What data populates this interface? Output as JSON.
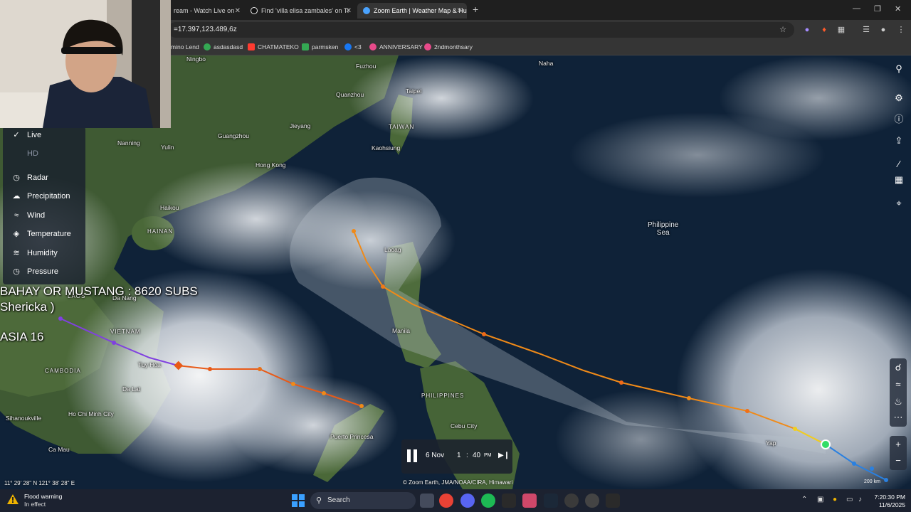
{
  "browser": {
    "tabs": [
      {
        "title": "ream - Watch Live on",
        "active": false
      },
      {
        "title": "Find 'villa elisa zambales' on Ti",
        "active": false
      },
      {
        "title": "Zoom Earth | Weather Map & Hu",
        "active": true
      }
    ],
    "url": "=17.397,123.489,6z",
    "bookmarks": [
      {
        "label": "mino Lend",
        "color": "#c9c9c9"
      },
      {
        "label": "asdasdasd",
        "color": "#34a853"
      },
      {
        "label": "CHATMATEKO",
        "color": "#ff3b30"
      },
      {
        "label": "parmsken",
        "color": "#34a853"
      },
      {
        "label": "<3",
        "color": "#1877f2"
      },
      {
        "label": "ANNIVERSARY",
        "color": "#e84a8a"
      },
      {
        "label": "2ndmonthsary",
        "color": "#e84a8a"
      }
    ]
  },
  "map": {
    "places": {
      "ningbo": "Ningbo",
      "fuzhou": "Fuzhou",
      "quanzhou": "Quanzhou",
      "taipei": "Taipei",
      "naha": "Naha",
      "jieyang": "Jieyang",
      "guangzhou": "Guangzhou",
      "taiwan": "TAIWAN",
      "kaohsiung": "Kaohsiung",
      "nanning": "Nanning",
      "yulin": "Yulin",
      "hongkong": "Hong Kong",
      "haikou": "Haikou",
      "hainan": "HAINAN",
      "philippine_sea": "Philippine\nSea",
      "laoag": "Laoag",
      "danang": "Da Nang",
      "laos": "LAOS",
      "vietnam": "VIETNAM",
      "tuyhoa": "Tuy Hòa",
      "manila": "Manila",
      "cambodia": "CAMBODIA",
      "dalat": "Da Lat",
      "philippines": "PHILIPPINES",
      "hochiminh": "Ho Chi Minh City",
      "sihanoukville": "Sihanoukville",
      "cebu": "Cebu City",
      "yap": "Yap",
      "camau": "Ca Mau",
      "puertoprincesa": "Puerto Princesa"
    },
    "coords": "11° 29' 28\" N  121° 38' 28\" E",
    "attribution": "© Zoom Earth, JMA/NOAA/CIRA, Himawari",
    "scale": "200 km",
    "icons": [
      "search-icon",
      "gear-icon",
      "info-icon",
      "share-icon",
      "measure-icon",
      "grid-icon",
      "locate-icon",
      "zoom-in-icon",
      "zoom-out-icon"
    ]
  },
  "layers": {
    "items": [
      {
        "label": "Live",
        "icon": "check-icon",
        "dim": false
      },
      {
        "label": "HD",
        "icon": "",
        "dim": true
      },
      {
        "label": "Radar",
        "icon": "radar-icon",
        "dim": false
      },
      {
        "label": "Precipitation",
        "icon": "precipitation-icon",
        "dim": false
      },
      {
        "label": "Wind",
        "icon": "wind-icon",
        "dim": false
      },
      {
        "label": "Temperature",
        "icon": "temperature-icon",
        "dim": false
      },
      {
        "label": "Humidity",
        "icon": "humidity-icon",
        "dim": false
      },
      {
        "label": "Pressure",
        "icon": "pressure-icon",
        "dim": false
      }
    ]
  },
  "overlay": {
    "line1": "BAHAY OR MUSTANG : 8620 SUBS",
    "line2": "Shericka )",
    "line3": "ASIA 16"
  },
  "time": {
    "date": "6 Nov",
    "hour": "1",
    "colon": ":",
    "minute": "40",
    "ampm": "PM"
  },
  "taskbar": {
    "weather_title": "Flood warning",
    "weather_sub": "In effect",
    "search": "Search",
    "time": "7:20:30 PM",
    "date": "11/6/2025"
  }
}
